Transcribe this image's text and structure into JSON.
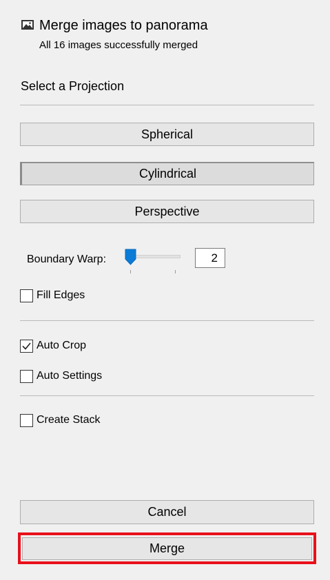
{
  "header": {
    "icon": "picture-icon",
    "title": "Merge images to panorama",
    "subtitle": "All 16 images successfully merged"
  },
  "projection": {
    "label": "Select a Projection",
    "options": [
      {
        "label": "Spherical",
        "selected": false
      },
      {
        "label": "Cylindrical",
        "selected": true
      },
      {
        "label": "Perspective",
        "selected": false
      }
    ]
  },
  "boundary_warp": {
    "label": "Boundary Warp:",
    "value": "2",
    "slider_min": 0,
    "slider_max": 100,
    "slider_value": 2
  },
  "options": {
    "fill_edges": {
      "label": "Fill Edges",
      "checked": false
    },
    "auto_crop": {
      "label": "Auto Crop",
      "checked": true
    },
    "auto_settings": {
      "label": "Auto Settings",
      "checked": false
    },
    "create_stack": {
      "label": "Create Stack",
      "checked": false
    }
  },
  "actions": {
    "cancel_label": "Cancel",
    "merge_label": "Merge"
  },
  "colors": {
    "slider_accent": "#0a7bd6",
    "highlight_frame": "#e8101a"
  }
}
